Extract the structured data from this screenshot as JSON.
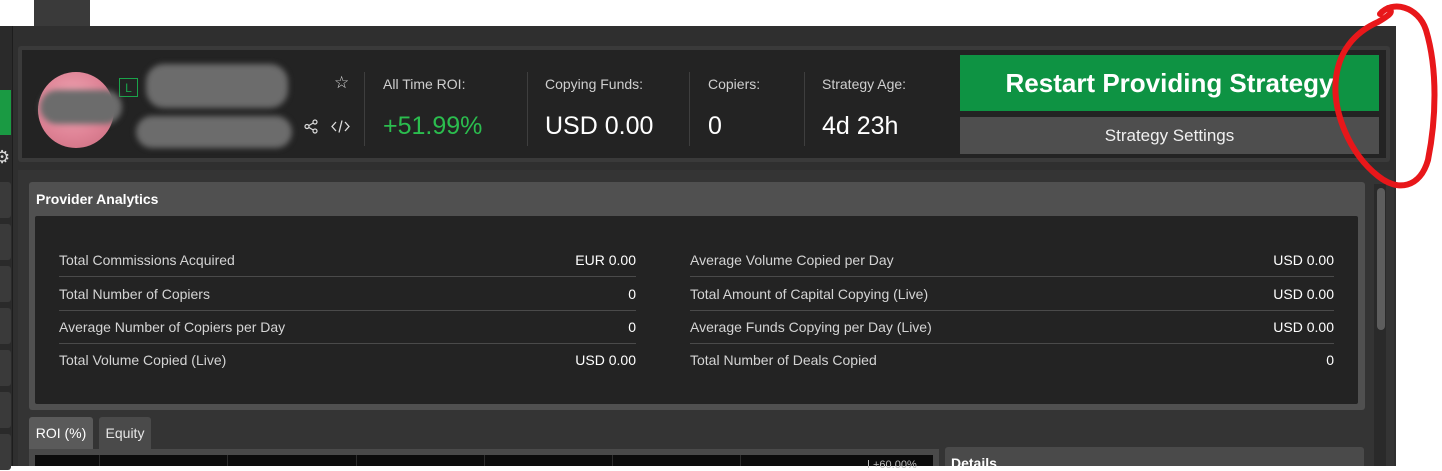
{
  "header": {
    "level_badge": "L",
    "stats": [
      {
        "label": "All Time ROI:",
        "value": "+51.99%"
      },
      {
        "label": "Copying Funds:",
        "value": "USD 0.00"
      },
      {
        "label": "Copiers:",
        "value": "0"
      },
      {
        "label": "Strategy Age:",
        "value": "4d 23h"
      }
    ],
    "restart_label": "Restart Providing Strategy",
    "settings_label": "Strategy Settings",
    "roi_color": "#2bbd4e",
    "accent_green": "#0e9343"
  },
  "icons": [
    "star-icon",
    "share-icon",
    "code-icon",
    "gear-icon"
  ],
  "analytics": {
    "title": "Provider Analytics",
    "left": [
      {
        "label": "Total Commissions Acquired",
        "value": "EUR 0.00"
      },
      {
        "label": "Total Number of Copiers",
        "value": "0"
      },
      {
        "label": "Average Number of Copiers per Day",
        "value": "0"
      },
      {
        "label": "Total Volume Copied (Live)",
        "value": "USD 0.00"
      }
    ],
    "right": [
      {
        "label": "Average Volume Copied per Day",
        "value": "USD 0.00"
      },
      {
        "label": "Total Amount of Capital Copying (Live)",
        "value": "USD 0.00"
      },
      {
        "label": "Average Funds Copying per Day (Live)",
        "value": "USD 0.00"
      },
      {
        "label": "Total Number of Deals Copied",
        "value": "0"
      }
    ]
  },
  "tabs": [
    {
      "label": "ROI (%)",
      "active": true
    },
    {
      "label": "Equity",
      "active": false
    }
  ],
  "chart": {
    "y_label": "+60.00%"
  },
  "details": {
    "title": "Details"
  }
}
